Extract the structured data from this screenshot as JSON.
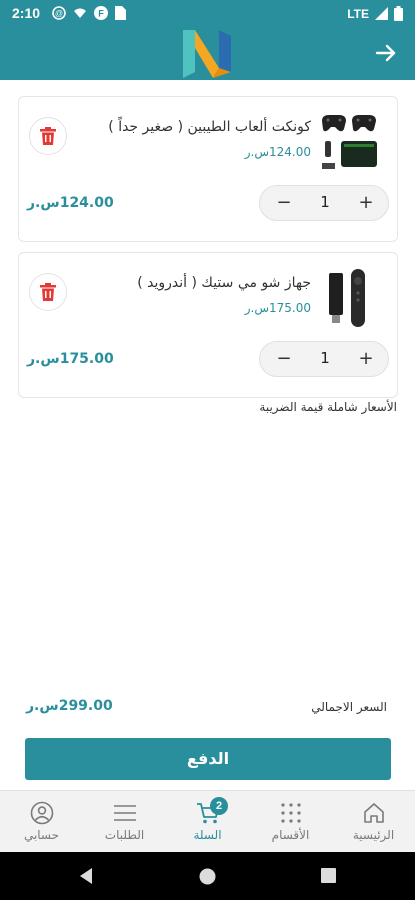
{
  "status_bar": {
    "time": "2:10",
    "network": "LTE",
    "icons": [
      "notification-icon",
      "wifi-icon",
      "app-icon",
      "sim-icon",
      "signal-icon",
      "battery-icon"
    ]
  },
  "header": {
    "logo": "N-logo",
    "back_icon": "arrow-right-icon"
  },
  "cart": {
    "items": [
      {
        "name": "كونكت ألعاب الطيبين ( صغير جداً )",
        "unit_price": "124.00س.ر",
        "quantity": "1",
        "line_total": "124.00س.ر",
        "minus": "−",
        "plus": "+"
      },
      {
        "name": "جهاز شو مي ستيك ( أندرويد )",
        "unit_price": "175.00س.ر",
        "quantity": "1",
        "line_total": "175.00س.ر",
        "minus": "−",
        "plus": "+"
      }
    ],
    "tax_note": "الأسعار شاملة قيمة الضريبة",
    "total_label": "السعر الاجمالي",
    "total_value": "299.00س.ر",
    "pay_label": "الدفع"
  },
  "bottom_nav": {
    "items": [
      {
        "label": "الرئيسية",
        "icon": "home-icon"
      },
      {
        "label": "الأقسام",
        "icon": "grid-icon"
      },
      {
        "label": "السلة",
        "icon": "cart-icon",
        "badge": "2"
      },
      {
        "label": "الطلبات",
        "icon": "list-icon"
      },
      {
        "label": "حسابي",
        "icon": "account-icon"
      }
    ]
  },
  "colors": {
    "primary": "#2a8f9c",
    "delete": "#e53935"
  }
}
